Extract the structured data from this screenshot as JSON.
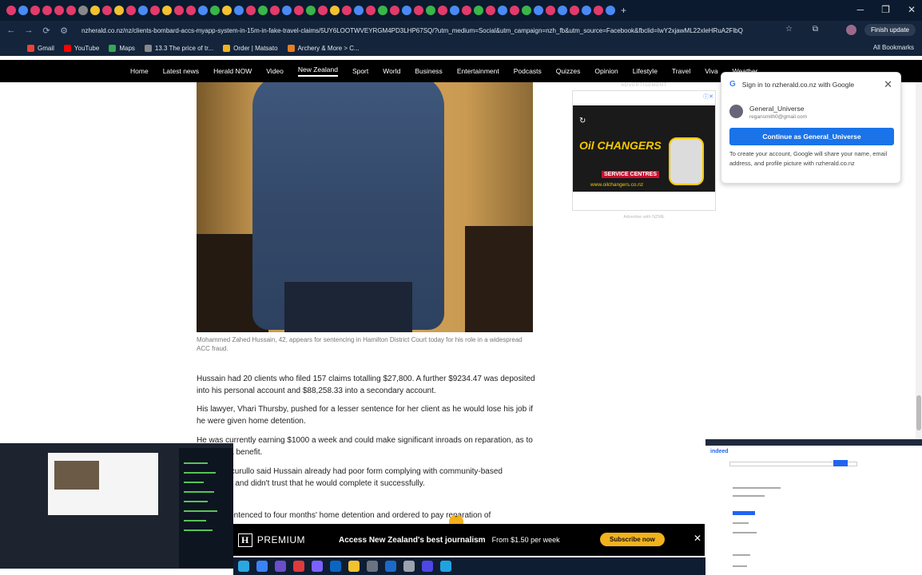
{
  "browser": {
    "url": "nzherald.co.nz/nz/clients-bombard-accs-myapp-system-in-15m-in-fake-travel-claims/5UY6LOOTWVEYRGM4PD3LHP67SQ/?utm_medium=Social&utm_campaign=nzh_fb&utm_source=Facebook&fbclid=IwY2xjawML22xleHRuA2FlbQ",
    "finish_update": "Finish update",
    "bookmarks": [
      "Gmail",
      "YouTube",
      "Maps",
      "13.3 The price of tr...",
      "Order | Matsato",
      "Archery & More > C..."
    ],
    "all_bookmarks": "All Bookmarks"
  },
  "site_nav": {
    "items": [
      "Home",
      "Latest news",
      "Herald NOW",
      "Video",
      "New Zealand",
      "Sport",
      "World",
      "Business",
      "Entertainment",
      "Podcasts",
      "Quizzes",
      "Opinion",
      "Lifestyle",
      "Travel",
      "Viva",
      "Weather"
    ],
    "active": "New Zealand"
  },
  "article": {
    "caption": "Mohammed Zahed Hussain, 42, appears for sentencing in Hamilton District Court today for his role in a widespread ACC fraud.",
    "paragraphs": [
      "Hussain had 20 clients who filed 157 claims totalling $27,800. A further $9234.47 was deposited into his personal account and $88,258.33 into a secondary account.",
      "His lawyer, Vhari Thursby, pushed for a lesser sentence for her client as he would lose his job if he were given home detention.",
      "He was currently earning $1000 a week and could make significant inroads on reparation, as to being on a benefit.",
      "Judge Cocurullo said Hussain already had poor form complying with community-based sentences and didn't trust that he would complete it successfully.",
      "He was sentenced to four months' home detention and ordered to pay reparation of"
    ]
  },
  "ad": {
    "label": "ADVERTISEMENT",
    "brand": "Oil CHANGERS",
    "sub": "SERVICE CENTRES",
    "url": "www.oilchangers.co.nz",
    "footer": "Advertise with NZME"
  },
  "google_signin": {
    "title": "Sign in to nzherald.co.nz with Google",
    "account_name": "General_Universe",
    "account_email": "regansmith0@gmail.com",
    "button": "Continue as General_Universe",
    "note": "To create your account, Google will share your name, email address, and profile picture with nzherald.co.nz"
  },
  "premium": {
    "brand": "PREMIUM",
    "message": "Access New Zealand's best journalism",
    "price": "From $1.50 per week",
    "button": "Subscribe now"
  }
}
